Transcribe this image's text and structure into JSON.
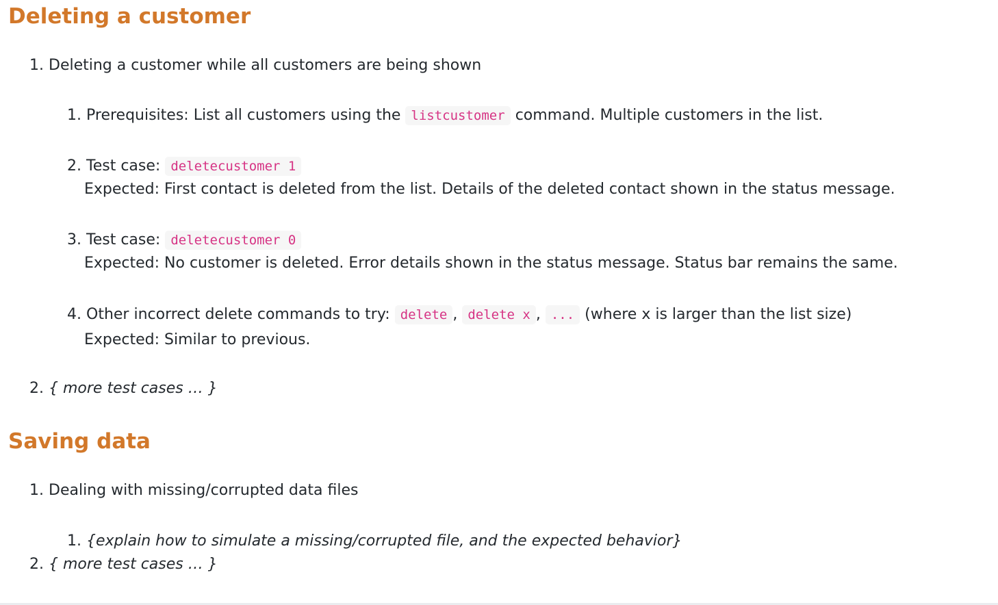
{
  "sections": [
    {
      "heading": "Deleting a customer",
      "item1": {
        "number": "1.",
        "text": "Deleting a customer while all customers are being shown",
        "steps": [
          {
            "number": "1.",
            "prefix": "Prerequisites: List all customers using the",
            "code": "listcustomer",
            "suffix": "command. Multiple customers in the list."
          },
          {
            "number": "2.",
            "prefix": "Test case:",
            "code": "deletecustomer 1",
            "expected": "Expected: First contact is deleted from the list. Details of the deleted contact shown in the status message."
          },
          {
            "number": "3.",
            "prefix": "Test case:",
            "code": "deletecustomer 0",
            "expected": "Expected: No customer is deleted. Error details shown in the status message. Status bar remains the same."
          },
          {
            "number": "4.",
            "prefix": "Other incorrect delete commands to try:",
            "codes": [
              "delete",
              "delete x",
              "..."
            ],
            "separator": ",",
            "suffix": "(where x is larger than the list size)",
            "expected": "Expected: Similar to previous."
          }
        ]
      },
      "item2": {
        "number": "2.",
        "text": "{ more test cases … }"
      }
    },
    {
      "heading": "Saving data",
      "item1": {
        "number": "1.",
        "text": "Dealing with missing/corrupted data files",
        "steps": [
          {
            "number": "1.",
            "text": "{explain how to simulate a missing/corrupted file, and the expected behavior}"
          }
        ]
      },
      "item2": {
        "number": "2.",
        "text": "{ more test cases … }"
      }
    }
  ],
  "colors": {
    "heading": "#d2782a",
    "code_text": "#d63384",
    "code_bg": "#f6f6f6",
    "body_text": "#24292e"
  }
}
